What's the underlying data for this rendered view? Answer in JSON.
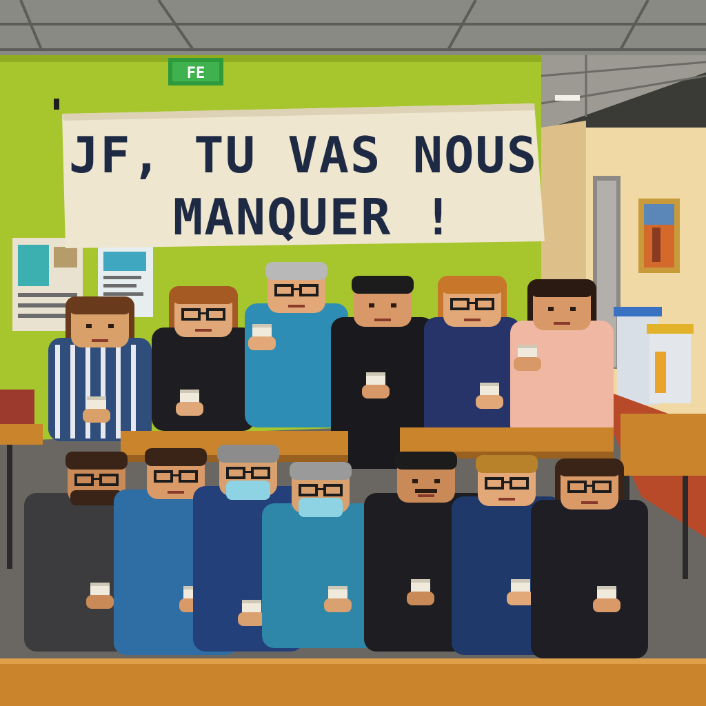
{
  "banner": {
    "line1": "JF, TU VAS NOUS",
    "line2": "MANQUER !"
  },
  "exit_sign": {
    "text": "FE"
  },
  "colors": {
    "wall_green": "#a7c52c",
    "ceiling": "#8a8a84",
    "hallway_wall": "#f1d9a5",
    "floor": "#6a6762",
    "table": "#c9842c",
    "banner": "#efe6cf",
    "banner_text": "#1e2a44",
    "exit_sign": "#2f9a3c"
  },
  "people": {
    "back_row_count": 6,
    "front_row_count": 7
  }
}
